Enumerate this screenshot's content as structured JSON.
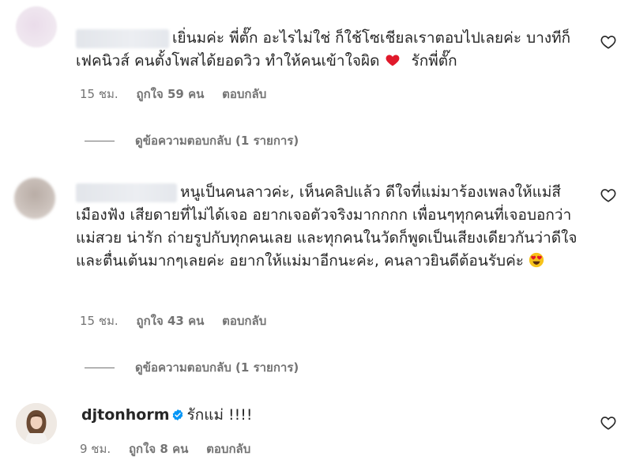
{
  "comments": [
    {
      "text": "เยิ่นมค่ะ พี่ตั๊ก อะไรไม่ใช่ ก็ใช้โซเชียลเราตอบไปเลยค่ะ บางทีก็เฟคนิวส์ คนตั้งโพสได้ยอดวิว ทำให้คนเข้าใจผิด",
      "text_after_emoji": "รักพี่ตั๊ก",
      "emoji": "red-heart",
      "time": "15 ชม.",
      "likes": "ถูกใจ 59 คน",
      "reply_label": "ตอบกลับ",
      "view_replies": "ดูข้อความตอบกลับ (1 รายการ)"
    },
    {
      "text": "หนูเป็นคนลาวค่ะ, เห็นคลิปแล้ว ดีใจที่แม่มาร้องเพลงให้แม่สีเมืองฟัง เสียดายที่ไม่ได้เจอ อยากเจอตัวจริงมากกกก เพื่อนๆทุกคนที่เจอบอกว่า แม่สวย น่ารัก ถ่ายรูปกับทุกคนเลย และทุกคนในวัดก็พูดเป็นเสียงเดียวกันว่าดีใจและตื่นเต้นมากๆเลยค่ะ อยากให้แม่มาอีกนะค่ะ, คนลาวยินดีต้อนรับค่ะ",
      "emoji": "heart-eyes",
      "time": "15 ชม.",
      "likes": "ถูกใจ 43 คน",
      "reply_label": "ตอบกลับ",
      "view_replies": "ดูข้อความตอบกลับ (1 รายการ)"
    },
    {
      "username": "djtonhorm",
      "text": "รักแม่ !!!!",
      "time": "9 ชม.",
      "likes": "ถูกใจ 8 คน",
      "reply_label": "ตอบกลับ"
    }
  ],
  "icons": {
    "like": "heart-outline-icon",
    "verified": "verified-badge-icon"
  },
  "colors": {
    "text": "#262626",
    "muted": "#737373",
    "verified": "#0095f6",
    "emoji_heart": "#e0192b"
  }
}
